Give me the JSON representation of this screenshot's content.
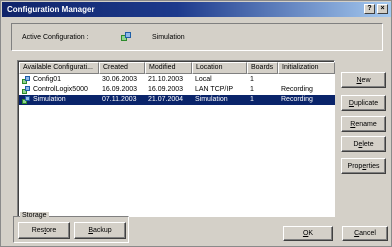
{
  "window": {
    "title": "Configuration Manager",
    "help_button": "?",
    "close_button": "×"
  },
  "active_configuration": {
    "label": "Active Configuration :",
    "value": "Simulation"
  },
  "table": {
    "columns": [
      "Available Configurati...",
      "Created",
      "Modified",
      "Location",
      "Boards",
      "Initialization"
    ],
    "rows": [
      {
        "name": "Config01",
        "created": "30.06.2003",
        "modified": "21.10.2003",
        "location": "Local",
        "boards": "1",
        "initialization": "",
        "selected": false
      },
      {
        "name": "ControlLogix5000",
        "created": "16.09.2003",
        "modified": "16.09.2003",
        "location": "LAN TCP/IP",
        "boards": "1",
        "initialization": "Recording",
        "selected": false
      },
      {
        "name": "Simulation",
        "created": "07.11.2003",
        "modified": "21.07.2004",
        "location": "Simulation",
        "boards": "1",
        "initialization": "Recording",
        "selected": true
      }
    ]
  },
  "side_buttons": {
    "new": {
      "pre": "",
      "u": "N",
      "post": "ew"
    },
    "duplicate": {
      "pre": "",
      "u": "D",
      "post": "uplicate"
    },
    "rename": {
      "pre": "",
      "u": "R",
      "post": "ename"
    },
    "delete": {
      "pre": "D",
      "u": "e",
      "post": "lete"
    },
    "properties": {
      "pre": "Prop",
      "u": "e",
      "post": "rties"
    }
  },
  "storage": {
    "label": "Storage",
    "restore": {
      "pre": "Res",
      "u": "t",
      "post": "ore"
    },
    "backup": {
      "pre": "",
      "u": "B",
      "post": "ackup"
    }
  },
  "footer": {
    "ok": {
      "pre": "",
      "u": "O",
      "post": "K"
    },
    "cancel": {
      "pre": "",
      "u": "C",
      "post": "ancel"
    }
  },
  "colors": {
    "selection": "#0a246a",
    "titlebar_start": "#10246a",
    "titlebar_end": "#a6caf0",
    "face": "#d4d0c8"
  },
  "icons": {
    "config": "config-icon",
    "active_config": "config-icon"
  }
}
